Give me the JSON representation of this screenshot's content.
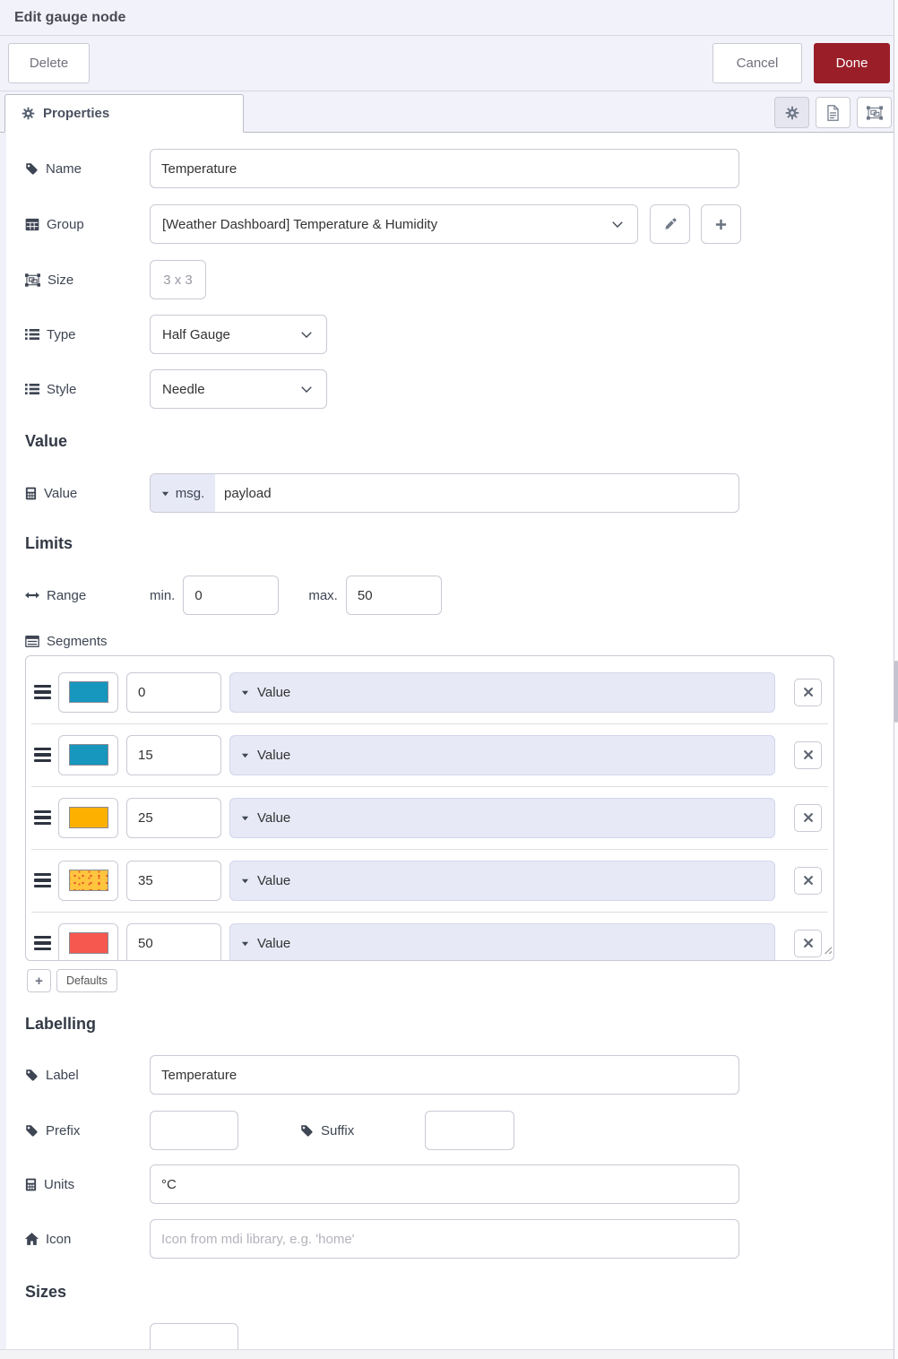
{
  "header": {
    "title": "Edit gauge node"
  },
  "toolbar": {
    "delete": "Delete",
    "cancel": "Cancel",
    "done": "Done"
  },
  "tab": {
    "properties": "Properties"
  },
  "form": {
    "name": {
      "label": "Name",
      "value": "Temperature"
    },
    "group": {
      "label": "Group",
      "value": "[Weather Dashboard] Temperature & Humidity"
    },
    "size": {
      "label": "Size",
      "value": "3 x 3"
    },
    "type": {
      "label": "Type",
      "value": "Half Gauge"
    },
    "style": {
      "label": "Style",
      "value": "Needle"
    }
  },
  "value_section": {
    "heading": "Value",
    "label": "Value",
    "prop_prefix": "msg.",
    "prop_value": "payload"
  },
  "limits_section": {
    "heading": "Limits",
    "range_label": "Range",
    "min_label": "min.",
    "min_value": "0",
    "max_label": "max.",
    "max_value": "50"
  },
  "segments": {
    "label": "Segments",
    "rows": [
      {
        "color": "#1796BE",
        "value": "0",
        "option": "Value"
      },
      {
        "color": "#1796BE",
        "value": "15",
        "option": "Value"
      },
      {
        "color": "#FDB000",
        "value": "25",
        "option": "Value"
      },
      {
        "color": "#FFC53E",
        "value": "35",
        "option": "Value"
      },
      {
        "color": "#F6584F",
        "value": "50",
        "option": "Value"
      }
    ],
    "add": "+",
    "defaults": "Defaults"
  },
  "labelling": {
    "heading": "Labelling",
    "label": {
      "label": "Label",
      "value": "Temperature"
    },
    "prefix": {
      "label": "Prefix",
      "value": ""
    },
    "suffix": {
      "label": "Suffix",
      "value": ""
    },
    "units": {
      "label": "Units",
      "value": "°C"
    },
    "icon": {
      "label": "Icon",
      "placeholder": "Icon from mdi library, e.g. 'home'"
    }
  },
  "sizes": {
    "heading": "Sizes"
  },
  "colors": {
    "done_red": "#9A1E28",
    "field_lavender": "#E7E9F7"
  }
}
